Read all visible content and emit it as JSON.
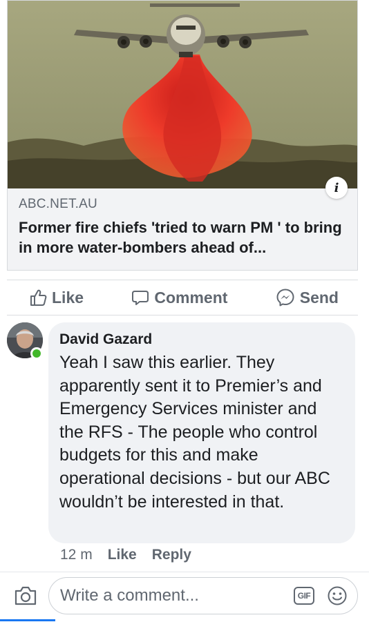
{
  "link_preview": {
    "domain": "ABC.NET.AU",
    "title": "Former fire chiefs 'tried to warn PM ' to bring in more water-bombers ahead of...",
    "info_icon": "info-icon",
    "info_glyph": "i",
    "image_icon": "air-tanker-photo"
  },
  "actions": {
    "like_label": "Like",
    "comment_label": "Comment",
    "send_label": "Send",
    "like_icon": "thumbs-up-icon",
    "comment_icon": "comment-bubble-icon",
    "send_icon": "messenger-icon"
  },
  "comment": {
    "author": "David Gazard",
    "text": "Yeah I saw this earlier. They apparently sent it to Premier’s and Emergency Services minister and the RFS - The people who control budgets for this and make operational decisions - but our ABC wouldn’t be interested in that.",
    "time": "12 m",
    "like_label": "Like",
    "reply_label": "Reply",
    "online": true
  },
  "composer": {
    "placeholder": "Write a comment...",
    "gif_label": "GIF",
    "camera_icon": "camera-icon",
    "emoji_icon": "emoji-icon"
  },
  "colors": {
    "accent_blue": "#1877f2",
    "online_green": "#42b72a",
    "retardant_red": "#f0392b",
    "muted_text": "#606770"
  }
}
